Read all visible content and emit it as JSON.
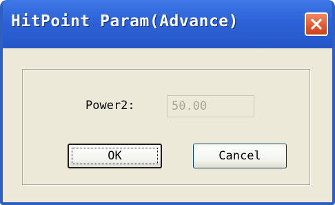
{
  "window": {
    "title": "HitPoint Param(Advance)",
    "close_icon": "close-x-icon"
  },
  "form": {
    "power_label": "Power2:",
    "power_value": "50.00"
  },
  "buttons": {
    "ok_label": "OK",
    "cancel_label": "Cancel"
  },
  "colors": {
    "titlebar": "#2d62d6",
    "close_button": "#e0582f",
    "client_background": "#ece9d8"
  }
}
